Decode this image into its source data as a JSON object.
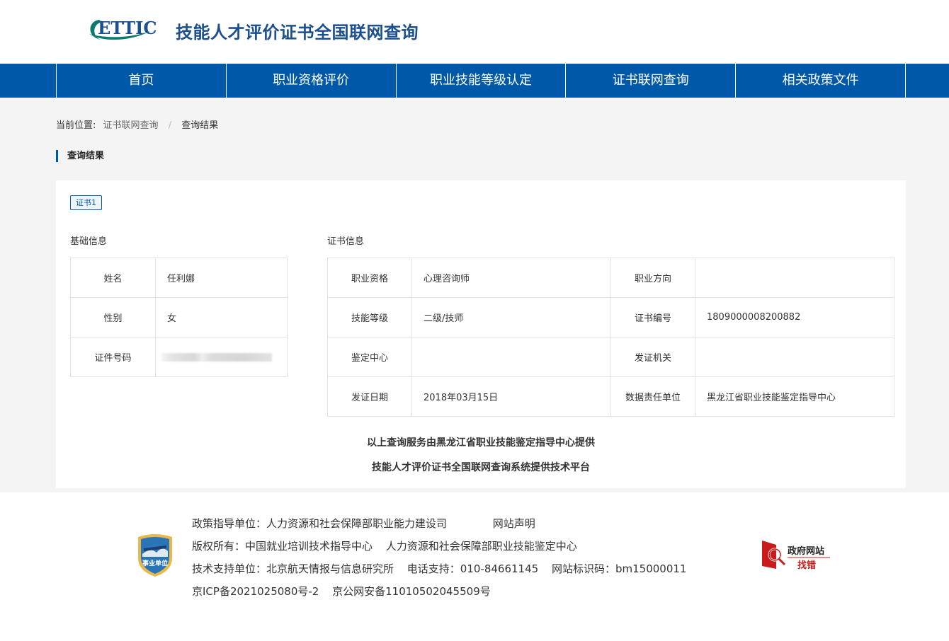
{
  "header": {
    "logo_text": "ETTIC",
    "title": "技能人才评价证书全国联网查询"
  },
  "nav": {
    "items": [
      {
        "label": "首页"
      },
      {
        "label": "职业资格评价"
      },
      {
        "label": "职业技能等级认定"
      },
      {
        "label": "证书联网查询"
      },
      {
        "label": "相关政策文件"
      }
    ]
  },
  "breadcrumb": {
    "prefix": "当前位置:",
    "link": "证书联网查询",
    "separator": "/",
    "current": "查询结果"
  },
  "section_title": "查询结果",
  "card": {
    "cert_tab": "证书1",
    "basic_title": "基础信息",
    "cert_title": "证书信息",
    "basic": [
      {
        "key": "姓名",
        "value": "任利娜"
      },
      {
        "key": "性别",
        "value": "女"
      },
      {
        "key": "证件号码",
        "value": ""
      }
    ],
    "cert_rows": [
      {
        "k1": "职业资格",
        "v1": "心理咨询师",
        "k2": "职业方向",
        "v2": ""
      },
      {
        "k1": "技能等级",
        "v1": "二级/技师",
        "k2": "证书编号",
        "v2": "1809000008200882"
      },
      {
        "k1": "鉴定中心",
        "v1": "",
        "k2": "发证机关",
        "v2": ""
      },
      {
        "k1": "发证日期",
        "v1": "2018年03月15日",
        "k2": "数据责任单位",
        "v2": "黑龙江省职业技能鉴定指导中心"
      }
    ],
    "provide_line1": "以上查询服务由黑龙江省职业技能鉴定指导中心提供",
    "provide_line2": "技能人才评价证书全国联网查询系统提供技术平台"
  },
  "footer": {
    "badge_text": "事业单位",
    "policy_unit": "政策指导单位：人力资源和社会保障部职业能力建设司",
    "statement": "网站声明",
    "copyright_prefix": "版权所有：中国就业培训技术指导中心",
    "copyright_second": "人力资源和社会保障部职业技能鉴定中心",
    "tech_support": "技术支持单位：北京航天情报与信息研究所",
    "phone": "电话支持：010-84661145",
    "site_code": "网站标识码：bm15000011",
    "icp": "京ICP备2021025080号-2",
    "police": "京公网安备11010502045509号",
    "gov_title": "政府网站",
    "gov_action": "找错"
  },
  "colors": {
    "nav_blue": "#0059a8",
    "title_blue": "#1b4f8e",
    "logo_teal": "#0a7a6a",
    "gov_red": "#c81c1c"
  }
}
